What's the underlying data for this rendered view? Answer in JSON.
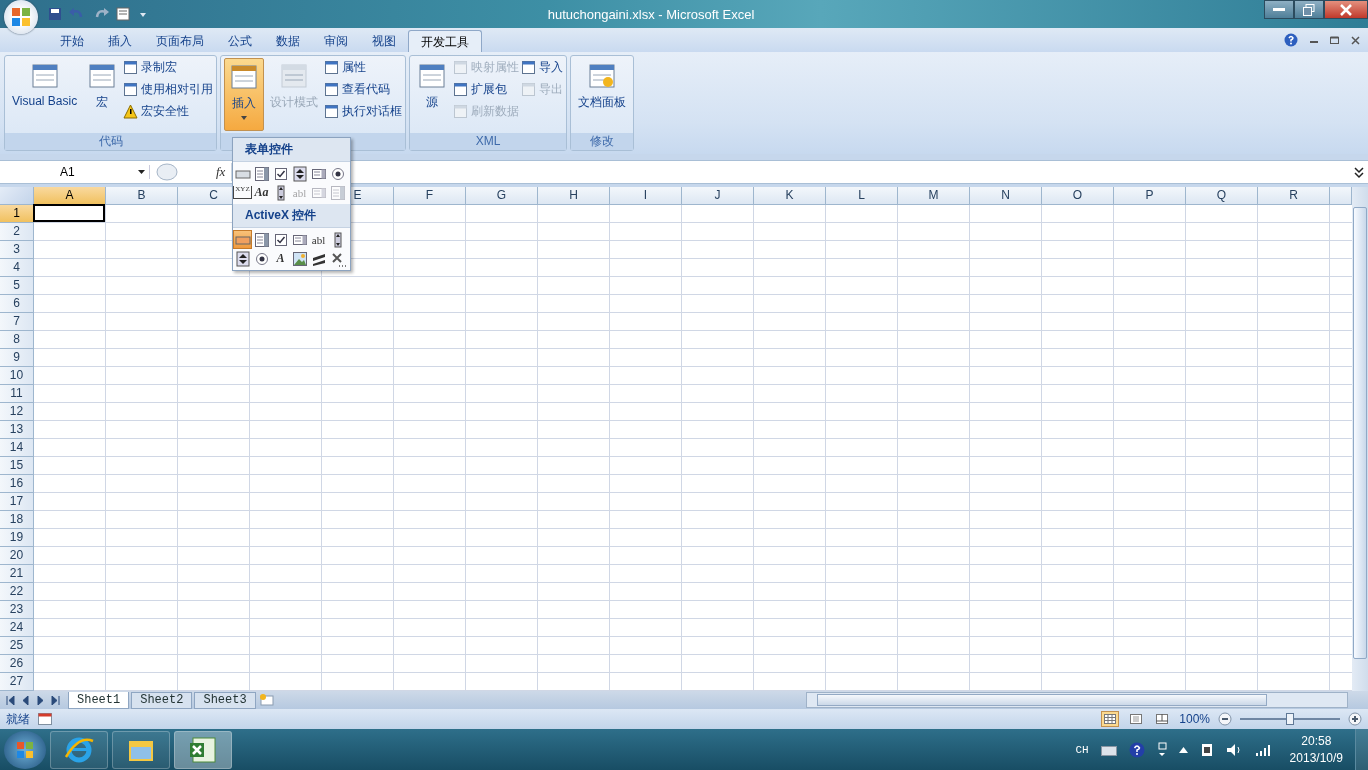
{
  "window": {
    "title": "hutuchongaini.xlsx - Microsoft Excel"
  },
  "tabs": [
    {
      "label": "开始",
      "selected": false
    },
    {
      "label": "插入",
      "selected": false
    },
    {
      "label": "页面布局",
      "selected": false
    },
    {
      "label": "公式",
      "selected": false
    },
    {
      "label": "数据",
      "selected": false
    },
    {
      "label": "审阅",
      "selected": false
    },
    {
      "label": "视图",
      "selected": false
    },
    {
      "label": "开发工具",
      "selected": true
    }
  ],
  "ribbon_groups": [
    {
      "label": "代码",
      "columns": [
        {
          "kind": "large",
          "items": [
            {
              "label": "Visual Basic",
              "disabled": false,
              "pressed": false
            }
          ]
        },
        {
          "kind": "large",
          "items": [
            {
              "label": "宏",
              "disabled": false,
              "pressed": false
            }
          ]
        },
        {
          "kind": "small",
          "items": [
            {
              "label": "录制宏",
              "disabled": false
            },
            {
              "label": "使用相对引用",
              "disabled": false
            },
            {
              "label": "宏安全性",
              "disabled": false
            }
          ]
        }
      ]
    },
    {
      "columns": [
        {
          "kind": "large",
          "items": [
            {
              "label": "插入",
              "disabled": false,
              "pressed": true
            }
          ]
        },
        {
          "kind": "large",
          "items": [
            {
              "label": "设计模式",
              "disabled": true,
              "pressed": false
            }
          ]
        },
        {
          "kind": "small",
          "items": [
            {
              "label": "属性",
              "disabled": false
            },
            {
              "label": "查看代码",
              "disabled": false
            },
            {
              "label": "执行对话框",
              "disabled": false
            }
          ]
        }
      ]
    },
    {
      "label": "XML",
      "columns": [
        {
          "kind": "large",
          "items": [
            {
              "label": "源",
              "disabled": false,
              "pressed": false
            }
          ]
        },
        {
          "kind": "small",
          "items": [
            {
              "label": "映射属性",
              "disabled": true
            },
            {
              "label": "扩展包",
              "disabled": false
            },
            {
              "label": "刷新数据",
              "disabled": true
            }
          ]
        },
        {
          "kind": "small",
          "items": [
            {
              "label": "导入",
              "disabled": false
            },
            {
              "label": "导出",
              "disabled": true
            }
          ]
        }
      ]
    },
    {
      "label": "修改",
      "columns": [
        {
          "kind": "large",
          "items": [
            {
              "label": "文档面板",
              "disabled": false,
              "pressed": false
            }
          ]
        }
      ]
    }
  ],
  "name_box": {
    "value": "A1"
  },
  "formula_bar": {
    "fx_label": "fx"
  },
  "columns": [
    {
      "label": "A",
      "selected": true
    },
    {
      "label": "B",
      "selected": false
    },
    {
      "label": "C",
      "selected": false
    },
    {},
    {
      "label": "E",
      "selected": false
    },
    {
      "label": "F",
      "selected": false
    },
    {
      "label": "G",
      "selected": false
    },
    {
      "label": "H",
      "selected": false
    },
    {
      "label": "I",
      "selected": false
    },
    {
      "label": "J",
      "selected": false
    },
    {
      "label": "K",
      "selected": false
    },
    {
      "label": "L",
      "selected": false
    },
    {
      "label": "M",
      "selected": false
    },
    {
      "label": "N",
      "selected": false
    },
    {
      "label": "O",
      "selected": false
    },
    {
      "label": "P",
      "selected": false
    },
    {
      "label": "Q",
      "selected": false
    },
    {
      "label": "R",
      "selected": false
    }
  ],
  "rows": [
    {
      "label": "1",
      "selected": true
    },
    {
      "label": "2",
      "selected": false
    },
    {
      "label": "3",
      "selected": false
    },
    {
      "label": "4",
      "selected": false
    },
    {
      "label": "5",
      "selected": false
    },
    {
      "label": "6",
      "selected": false
    },
    {
      "label": "7",
      "selected": false
    },
    {
      "label": "8",
      "selected": false
    },
    {
      "label": "9",
      "selected": false
    },
    {
      "label": "10",
      "selected": false
    },
    {
      "label": "11",
      "selected": false
    },
    {
      "label": "12",
      "selected": false
    },
    {
      "label": "13",
      "selected": false
    },
    {
      "label": "14",
      "selected": false
    },
    {
      "label": "15",
      "selected": false
    },
    {
      "label": "16",
      "selected": false
    },
    {
      "label": "17",
      "selected": false
    },
    {
      "label": "18",
      "selected": false
    },
    {
      "label": "19",
      "selected": false
    },
    {
      "label": "20",
      "selected": false
    },
    {
      "label": "21",
      "selected": false
    },
    {
      "label": "22",
      "selected": false
    },
    {
      "label": "23",
      "selected": false
    },
    {
      "label": "24",
      "selected": false
    },
    {
      "label": "25",
      "selected": false
    },
    {
      "label": "26",
      "selected": false
    },
    {
      "label": "27",
      "selected": false
    }
  ],
  "insert_menu": {
    "sections": [
      {
        "title": "表单控件",
        "controls": [
          {
            "kind": "button",
            "selected": false
          },
          {
            "kind": "combo",
            "selected": false
          },
          {
            "kind": "checkbox",
            "selected": false
          },
          {
            "kind": "spinner",
            "selected": false
          },
          {
            "kind": "listbox",
            "selected": false
          },
          {
            "kind": "radio",
            "selected": false
          },
          {
            "kind": "groupbox",
            "glyph": "XYZ",
            "selected": false
          },
          {
            "kind": "label",
            "glyph": "Aa",
            "selected": false
          },
          {
            "kind": "scrollbar",
            "selected": false
          },
          {
            "kind": "textfield",
            "glyph": "abl",
            "selected": false,
            "disabled": true
          },
          {
            "kind": "listbox",
            "selected": false,
            "disabled": true
          },
          {
            "kind": "combo",
            "selected": false,
            "disabled": true
          }
        ]
      },
      {
        "title": "ActiveX 控件",
        "controls": [
          {
            "kind": "button",
            "selected": true
          },
          {
            "kind": "combo",
            "selected": false
          },
          {
            "kind": "checkbox",
            "selected": false
          },
          {
            "kind": "listbox",
            "selected": false
          },
          {
            "kind": "textfield",
            "glyph": "abl",
            "selected": false
          },
          {
            "kind": "scrollbar",
            "selected": false
          },
          {
            "kind": "spinner",
            "selected": false
          },
          {
            "kind": "radio",
            "selected": false
          },
          {
            "kind": "label",
            "glyph": "A",
            "selected": false
          },
          {
            "kind": "image",
            "selected": false
          },
          {
            "kind": "toggle",
            "selected": false
          },
          {
            "kind": "more",
            "selected": false
          }
        ]
      }
    ]
  },
  "sheet_tabs": [
    {
      "label": "Sheet1",
      "selected": true
    },
    {
      "label": "Sheet2",
      "selected": false
    },
    {
      "label": "Sheet3",
      "selected": false
    }
  ],
  "status_bar": {
    "status": "就绪",
    "views": [
      {
        "kind": "normal",
        "selected": true
      },
      {
        "kind": "layout",
        "selected": false
      },
      {
        "kind": "pagebreak",
        "selected": false
      }
    ],
    "zoom": "100%",
    "zoom_level": {
      "level": 0.5
    }
  },
  "taskbar": {
    "apps": [
      {
        "kind": "browser",
        "selected": false
      },
      {
        "kind": "folder",
        "selected": false
      },
      {
        "kind": "spreadsheet",
        "selected": true
      }
    ],
    "input_language": "CH",
    "time": "20:58",
    "date": "2013/10/9"
  }
}
